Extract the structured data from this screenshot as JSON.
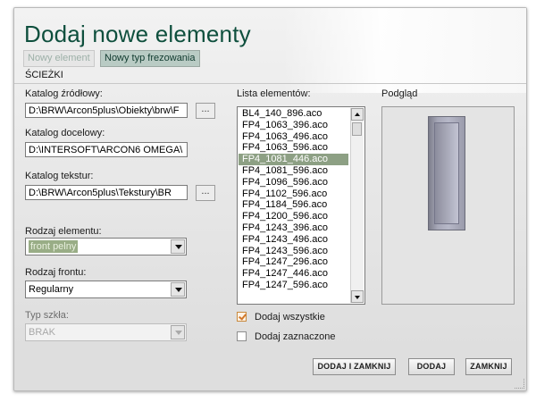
{
  "dialog": {
    "title": "Dodaj nowe elementy",
    "tabs": [
      {
        "label": "Nowy element"
      },
      {
        "label": "Nowy typ frezowania"
      }
    ],
    "section_label": "ŚCIEŻKI"
  },
  "paths": {
    "source": {
      "label": "Katalog źródłowy:",
      "value": "D:\\BRW\\Arcon5plus\\Obiekty\\brw\\F"
    },
    "target": {
      "label": "Katalog docelowy:",
      "value": "D:\\INTERSOFT\\ARCON6 OMEGA\\"
    },
    "textures": {
      "label": "Katalog tekstur:",
      "value": "D:\\BRW\\Arcon5plus\\Tekstury\\BR"
    },
    "browse_label": "..."
  },
  "element_type": {
    "label": "Rodzaj elementu:",
    "value": "front pelny"
  },
  "front_type": {
    "label": "Rodzaj frontu:",
    "value": "Regularny"
  },
  "glass_type": {
    "label": "Typ szkła:",
    "value": "BRAK"
  },
  "elements_list": {
    "label": "Lista elementów:",
    "items": [
      "BL4_140_896.aco",
      "FP4_1063_396.aco",
      "FP4_1063_496.aco",
      "FP4_1063_596.aco",
      "FP4_1081_446.aco",
      "FP4_1081_596.aco",
      "FP4_1096_596.aco",
      "FP4_1102_596.aco",
      "FP4_1184_596.aco",
      "FP4_1200_596.aco",
      "FP4_1243_396.aco",
      "FP4_1243_496.aco",
      "FP4_1243_596.aco",
      "FP4_1247_296.aco",
      "FP4_1247_446.aco",
      "FP4_1247_596.aco"
    ],
    "selected_index": 4
  },
  "preview": {
    "label": "Podgląd"
  },
  "options": {
    "add_all": {
      "label": "Dodaj wszystkie",
      "checked": true
    },
    "add_selected": {
      "label": "Dodaj zaznaczone",
      "checked": false
    }
  },
  "buttons": {
    "add_and_close": "DODAJ I ZAMKNIJ",
    "add": "DODAJ",
    "close": "ZAMKNIJ"
  }
}
